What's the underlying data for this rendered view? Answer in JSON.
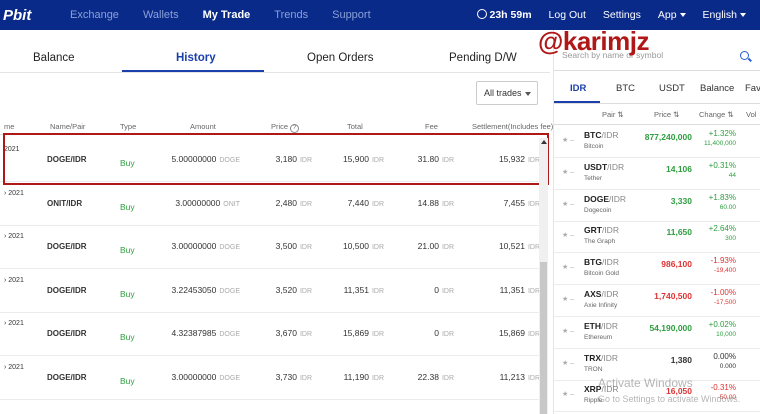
{
  "topbar": {
    "logo": "Pbit",
    "nav": [
      "Exchange",
      "Wallets",
      "My Trade",
      "Trends",
      "Support"
    ],
    "active_nav": "My Trade",
    "timer": "23h 59m",
    "logout": "Log Out",
    "settings": "Settings",
    "app": "App",
    "language": "English"
  },
  "tabs": {
    "balance": "Balance",
    "history": "History",
    "open_orders": "Open Orders",
    "pending": "Pending D/W"
  },
  "filter": {
    "selected": "All trades"
  },
  "table": {
    "headers": {
      "time": "me",
      "pair": "Name/Pair",
      "type": "Type",
      "amount": "Amount",
      "price": "Price",
      "total": "Total",
      "fee": "Fee",
      "settlement": "Settlement(Includes fee)"
    },
    "rows": [
      {
        "date": "2021",
        "pair": "DOGE/IDR",
        "type": "Buy",
        "amount": "5.00000000",
        "amount_unit": "DOGE",
        "price": "3,180",
        "price_unit": "IDR",
        "total": "15,900",
        "total_unit": "IDR",
        "fee": "31.80",
        "fee_unit": "IDR",
        "settlement": "15,932",
        "settlement_unit": "IDR"
      },
      {
        "date": "› 2021",
        "pair": "ONIT/IDR",
        "type": "Buy",
        "amount": "3.00000000",
        "amount_unit": "ONIT",
        "price": "2,480",
        "price_unit": "IDR",
        "total": "7,440",
        "total_unit": "IDR",
        "fee": "14.88",
        "fee_unit": "IDR",
        "settlement": "7,455",
        "settlement_unit": "IDR"
      },
      {
        "date": "› 2021",
        "pair": "DOGE/IDR",
        "type": "Buy",
        "amount": "3.00000000",
        "amount_unit": "DOGE",
        "price": "3,500",
        "price_unit": "IDR",
        "total": "10,500",
        "total_unit": "IDR",
        "fee": "21.00",
        "fee_unit": "IDR",
        "settlement": "10,521",
        "settlement_unit": "IDR"
      },
      {
        "date": "› 2021",
        "pair": "DOGE/IDR",
        "type": "Buy",
        "amount": "3.22453050",
        "amount_unit": "DOGE",
        "price": "3,520",
        "price_unit": "IDR",
        "total": "11,351",
        "total_unit": "IDR",
        "fee": "0",
        "fee_unit": "IDR",
        "settlement": "11,351",
        "settlement_unit": "IDR"
      },
      {
        "date": "› 2021",
        "pair": "DOGE/IDR",
        "type": "Buy",
        "amount": "4.32387985",
        "amount_unit": "DOGE",
        "price": "3,670",
        "price_unit": "IDR",
        "total": "15,869",
        "total_unit": "IDR",
        "fee": "0",
        "fee_unit": "IDR",
        "settlement": "15,869",
        "settlement_unit": "IDR"
      },
      {
        "date": "› 2021",
        "pair": "DOGE/IDR",
        "type": "Buy",
        "amount": "3.00000000",
        "amount_unit": "DOGE",
        "price": "3,730",
        "price_unit": "IDR",
        "total": "11,190",
        "total_unit": "IDR",
        "fee": "22.38",
        "fee_unit": "IDR",
        "settlement": "11,213",
        "settlement_unit": "IDR"
      }
    ]
  },
  "market": {
    "search_placeholder": "Search by name or symbol",
    "tabs": [
      "IDR",
      "BTC",
      "USDT",
      "Balance",
      "Fav"
    ],
    "headers": {
      "pair": "Pair",
      "price": "Price",
      "change": "Change",
      "vol": "Vol"
    },
    "rows": [
      {
        "base": "BTC",
        "quote": "/IDR",
        "name": "Bitcoin",
        "price": "877,240,000",
        "change": "+1.32%",
        "change_abs": "11,400,000",
        "dir": "up"
      },
      {
        "base": "USDT",
        "quote": "/IDR",
        "name": "Tether",
        "price": "14,106",
        "change": "+0.31%",
        "change_abs": "44",
        "dir": "up"
      },
      {
        "base": "DOGE",
        "quote": "/IDR",
        "name": "Dogecoin",
        "price": "3,330",
        "change": "+1.83%",
        "change_abs": "60.00",
        "dir": "up"
      },
      {
        "base": "GRT",
        "quote": "/IDR",
        "name": "The Graph",
        "price": "11,650",
        "change": "+2.64%",
        "change_abs": "300",
        "dir": "up"
      },
      {
        "base": "BTG",
        "quote": "/IDR",
        "name": "Bitcoin Gold",
        "price": "986,100",
        "change": "-1.93%",
        "change_abs": "-19,400",
        "dir": "down"
      },
      {
        "base": "AXS",
        "quote": "/IDR",
        "name": "Axie Infinity",
        "price": "1,740,500",
        "change": "-1.00%",
        "change_abs": "-17,500",
        "dir": "down"
      },
      {
        "base": "ETH",
        "quote": "/IDR",
        "name": "Ethereum",
        "price": "54,190,000",
        "change": "+0.02%",
        "change_abs": "10,000",
        "dir": "up"
      },
      {
        "base": "TRX",
        "quote": "/IDR",
        "name": "TRON",
        "price": "1,380",
        "change": "0.00%",
        "change_abs": "0.000",
        "dir": "flat"
      },
      {
        "base": "XRP",
        "quote": "/IDR",
        "name": "Ripple",
        "price": "16,050",
        "change": "-0.31%",
        "change_abs": "-50.00",
        "dir": "down"
      }
    ]
  },
  "overlay": {
    "handle": "@karimjz"
  },
  "watermark": {
    "line1": "Activate Windows",
    "line2": "Go to Settings to activate Windows."
  }
}
